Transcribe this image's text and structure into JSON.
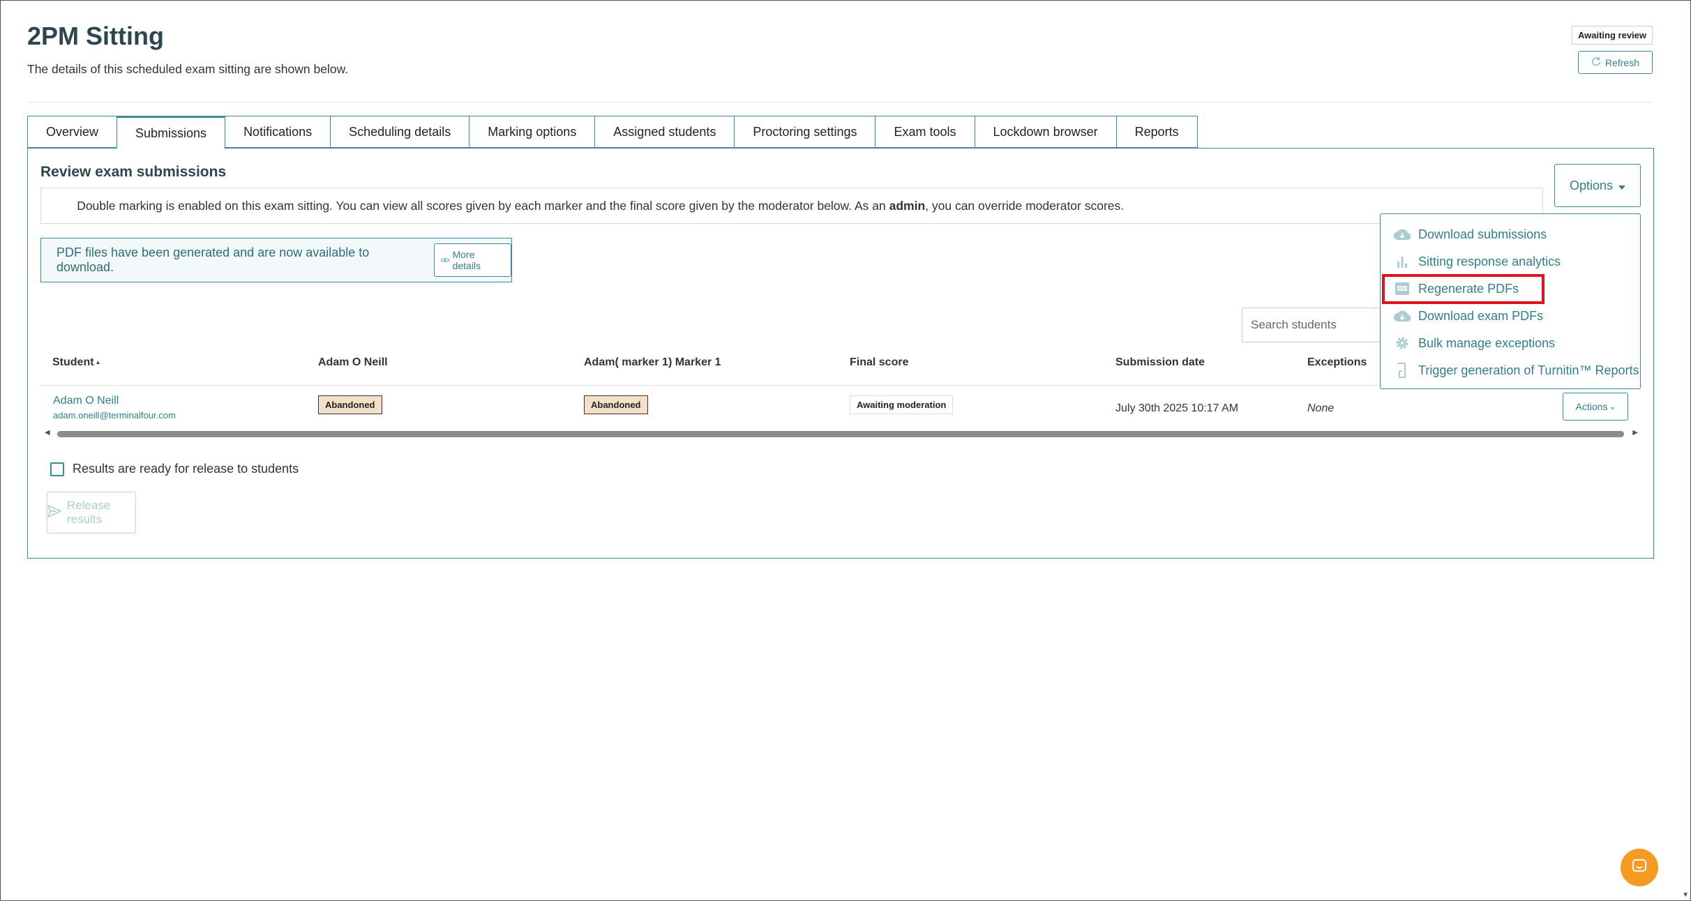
{
  "header": {
    "title": "2PM Sitting",
    "subtitle": "The details of this scheduled exam sitting are shown below.",
    "status_badge": "Awaiting review",
    "refresh_label": "Refresh"
  },
  "tabs": [
    {
      "label": "Overview",
      "active": false
    },
    {
      "label": "Submissions",
      "active": true
    },
    {
      "label": "Notifications",
      "active": false
    },
    {
      "label": "Scheduling details",
      "active": false
    },
    {
      "label": "Marking options",
      "active": false
    },
    {
      "label": "Assigned students",
      "active": false
    },
    {
      "label": "Proctoring settings",
      "active": false
    },
    {
      "label": "Exam tools",
      "active": false
    },
    {
      "label": "Lockdown browser",
      "active": false
    },
    {
      "label": "Reports",
      "active": false
    }
  ],
  "submissions": {
    "title": "Review exam submissions",
    "info_prefix": "Double marking is enabled on this exam sitting. You can view all scores given by each marker and the final score given by the moderator below. As an ",
    "info_role": "admin",
    "info_suffix": ", you can override moderator scores.",
    "pdf_alert": "PDF files have been generated and are now available to download.",
    "more_details_label": "More details",
    "options_label": "Options",
    "search_placeholder": "Search students",
    "columns": [
      "Student",
      "Adam O Neill",
      "Adam( marker 1) Marker 1",
      "Final score",
      "Submission date",
      "Exceptions"
    ],
    "sort_indicator": "▲",
    "rows": [
      {
        "student_name": "Adam O Neill",
        "student_email": "adam.oneill@terminalfour.com",
        "marker_a": "Abandoned",
        "marker_b": "Abandoned",
        "final_score": "Awaiting moderation",
        "submission_date": "July 30th 2025 10:17 AM",
        "exceptions": "None",
        "actions_label": "Actions"
      }
    ],
    "release_checkbox_label": "Results are ready for release to students",
    "release_button_label": "Release results"
  },
  "options_menu": [
    {
      "label": "Download submissions",
      "icon": "cloud-download-icon"
    },
    {
      "label": "Sitting response analytics",
      "icon": "bar-chart-icon"
    },
    {
      "label": "Regenerate PDFs",
      "icon": "pdf-file-icon",
      "highlighted": true
    },
    {
      "label": "Download exam PDFs",
      "icon": "cloud-download-icon"
    },
    {
      "label": "Bulk manage exceptions",
      "icon": "gear-icon"
    },
    {
      "label": "Trigger generation of Turnitin™ Reports",
      "icon": "turnitin-icon"
    }
  ],
  "colors": {
    "accent": "#3b8c97",
    "link": "#2f7f8c",
    "title": "#2c4650",
    "highlight": "#e0141e",
    "chat_launcher": "#f59a23",
    "abandoned_badge": "#f4dfc9"
  }
}
